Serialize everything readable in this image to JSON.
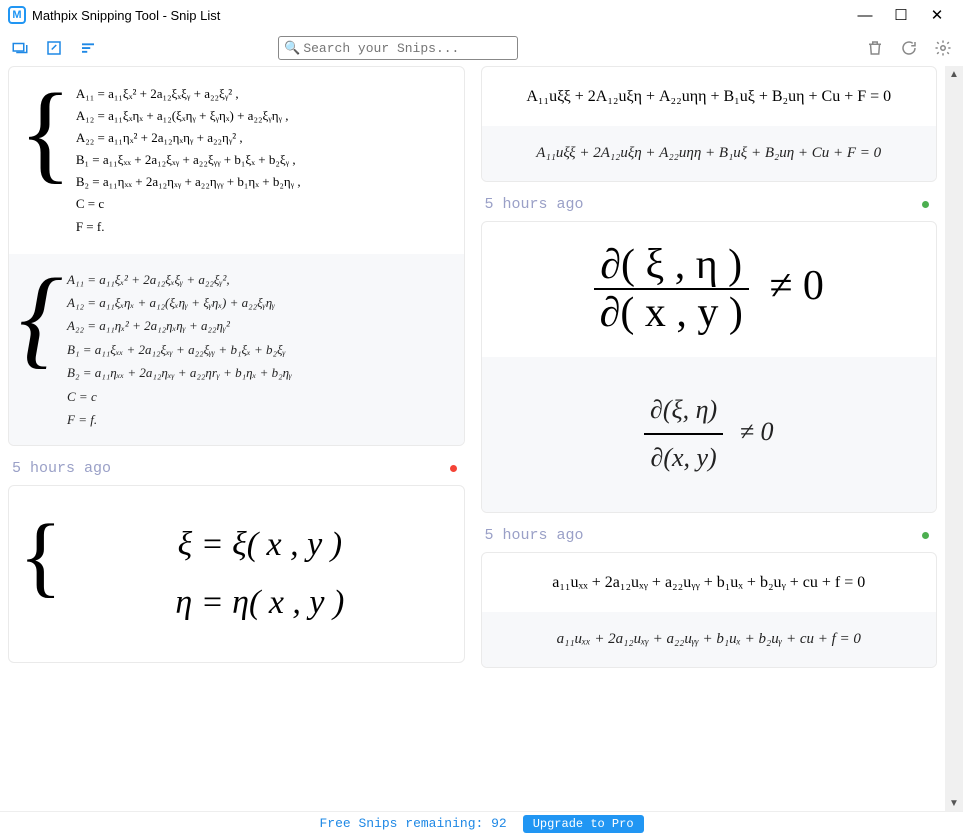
{
  "window": {
    "logo_letter": "M",
    "title": "Mathpix Snipping Tool - Snip List",
    "buttons": {
      "min": "—",
      "max": "☐",
      "close": "✕"
    }
  },
  "toolbar": {
    "icons": {
      "snip": "snip",
      "edit": "edit",
      "list": "list",
      "trash": "trash",
      "refresh": "refresh",
      "settings": "settings"
    }
  },
  "search": {
    "placeholder": "Search your Snips..."
  },
  "left": {
    "card1": {
      "orig": [
        "A₁₁ = a₁₁ξₓ² + 2a₁₂ξₓξᵧ + a₂₂ξᵧ² ,",
        "A₁₂ = a₁₁ξₓηₓ + a₁₂(ξₓηᵧ + ξᵧηₓ) + a₂₂ξᵧηᵧ ,",
        "A₂₂ = a₁₁ηₓ² + 2a₁₂ηₓηᵧ + a₂₂ηᵧ² ,",
        "B₁ = a₁₁ξₓₓ + 2a₁₂ξₓᵧ + a₂₂ξᵧᵧ + b₁ξₓ + b₂ξᵧ ,",
        "B₂ = a₁₁ηₓₓ + 2a₁₂ηₓᵧ + a₂₂ηᵧᵧ + b₁ηₓ + b₂ηᵧ ,",
        "C = c",
        "F = f."
      ],
      "render": [
        "A₁₁ = a₁₁ξₓ² + 2a₁₂ξₓξᵧ + a₂₂ξᵧ²,",
        "A₁₂ = a₁₁ξₓηₓ + a₁₂(ξₓηᵧ + ξᵧηₓ) + a₂₂ξᵧηᵧ",
        "A₂₂ = a₁₁ηₓ² + 2a₁₂ηₓηᵧ + a₂₂ηᵧ²",
        "B₁ = a₁₁ξₓₓ + 2a₁₂ξₓᵧ + a₂₂ξᵧᵧ + b₁ξₓ + b₂ξᵧ",
        "B₂ = a₁₁ηₓₓ + 2a₁₂ηₓᵧ + a₂₂ηrᵧ + b₁ηₓ + b₂ηᵧ",
        "C = c",
        "F = f."
      ]
    },
    "ts1": "5 hours ago",
    "card2": {
      "orig_l1": "ξ = ξ( x , y )",
      "orig_l2": "η = η( x , y )"
    }
  },
  "right": {
    "card1": {
      "orig": "A₁₁uξξ + 2A₁₂uξη + A₂₂uηη + B₁uξ + B₂uη + Cu + F = 0",
      "render": "A₁₁uξξ + 2A₁₂uξη + A₂₂uηη + B₁uξ + B₂uη + Cu + F = 0"
    },
    "ts1": "5 hours ago",
    "card2": {
      "orig_num": "∂( ξ , η )",
      "orig_den": "∂( x , y )",
      "orig_ne": "≠ 0",
      "render_num": "∂(ξ, η)",
      "render_den": "∂(x, y)",
      "render_ne": "≠ 0"
    },
    "ts2": "5 hours ago",
    "card3": {
      "orig": "a₁₁uₓₓ + 2a₁₂uₓᵧ + a₂₂uᵧᵧ + b₁uₓ + b₂uᵧ + cu + f = 0",
      "render": "a₁₁uₓₓ + 2a₁₂uₓᵧ + a₂₂uᵧᵧ + b₁uₓ + b₂uᵧ + cu + f = 0"
    }
  },
  "status": {
    "free": "Free Snips remaining: 92",
    "upgrade": "Upgrade to Pro"
  }
}
